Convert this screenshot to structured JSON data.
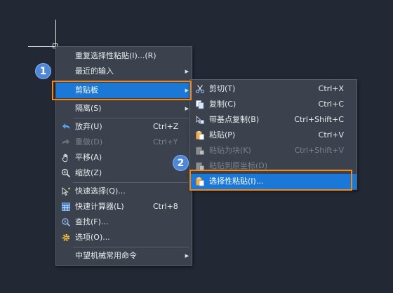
{
  "main_menu": {
    "items": [
      {
        "label": "重复选择性粘贴(I)...(R)"
      },
      {
        "label": "最近的输入"
      },
      {
        "label": "剪贴板"
      },
      {
        "label": "隔离(S)"
      },
      {
        "label": "放弃(U)",
        "shortcut": "Ctrl+Z"
      },
      {
        "label": "重做(D)",
        "shortcut": "Ctrl+Y"
      },
      {
        "label": "平移(A)"
      },
      {
        "label": "缩放(Z)"
      },
      {
        "label": "快速选择(Q)..."
      },
      {
        "label": "快速计算器(L)",
        "shortcut": "Ctrl+8"
      },
      {
        "label": "查找(F)..."
      },
      {
        "label": "选项(O)..."
      },
      {
        "label": "中望机械常用命令"
      }
    ]
  },
  "clipboard_submenu": {
    "items": [
      {
        "label": "剪切(T)",
        "shortcut": "Ctrl+X"
      },
      {
        "label": "复制(C)",
        "shortcut": "Ctrl+C"
      },
      {
        "label": "带基点复制(B)",
        "shortcut": "Ctrl+Shift+C"
      },
      {
        "label": "粘贴(P)",
        "shortcut": "Ctrl+V"
      },
      {
        "label": "粘贴为块(K)",
        "shortcut": "Ctrl+Shift+V"
      },
      {
        "label": "粘贴到原坐标(D)"
      },
      {
        "label": "选择性粘贴(I)..."
      }
    ]
  },
  "annotations": {
    "step1": "1",
    "step2": "2"
  },
  "colors": {
    "background": "#222834",
    "menu": "#3b424d",
    "highlight": "#1b78d6",
    "annotation_box": "#f2891b",
    "badge": "#4f87d8"
  }
}
